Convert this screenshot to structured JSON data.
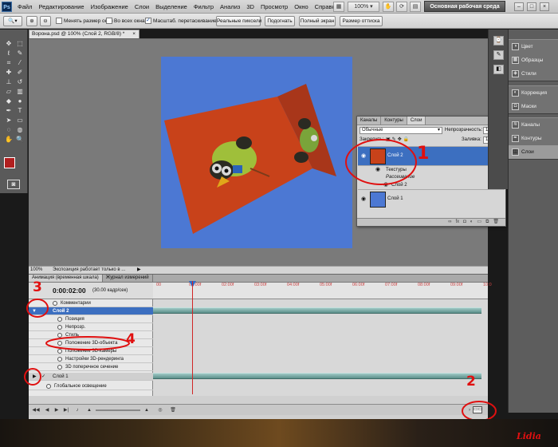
{
  "app": {
    "logo": "Ps",
    "menu": [
      "Файл",
      "Редактирование",
      "Изображение",
      "Слои",
      "Выделение",
      "Фильтр",
      "Анализ",
      "3D",
      "Просмотр",
      "Окно",
      "Справка"
    ],
    "zoom_label": "100%",
    "workspace_button": "Основная рабочая среда"
  },
  "options": {
    "check_resize": "Менять размер окон",
    "check_all_windows": "Во всех окнах",
    "check_scrubby": "Масштаб. перетаскиванием",
    "btn_actual_pixels": "Реальные пиксели",
    "btn_fit": "Подогнать",
    "btn_fullscreen": "Полный экран",
    "btn_print_size": "Размер оттиска"
  },
  "document": {
    "tab_title": "Ворона.psd @ 100% (Слой 2, RGB/8) *",
    "tab_close": "×",
    "status_zoom": "100%",
    "status_text": "Экспозиция работает только в ..."
  },
  "colors": {
    "canvas_blue": "#4c78d3",
    "cube_red": "#c8421a",
    "selection_blue": "#3c6fc0",
    "annotation_red": "#e01010"
  },
  "layers": {
    "tabs": [
      "Каналы",
      "Контуры",
      "Слои"
    ],
    "blend_mode": "Обычные",
    "opacity_label": "Непрозрачность:",
    "opacity_value": "100%",
    "lock_label": "Закрепить:",
    "fill_label": "Заливка:",
    "fill_value": "100%",
    "items": [
      {
        "name": "Слой 2",
        "sub": [
          "Текстуры",
          "Рассеивание",
          "Слой 2"
        ]
      },
      {
        "name": "Слой 1"
      }
    ]
  },
  "right_dock": {
    "group1": [
      "Цвет",
      "Образцы",
      "Стили"
    ],
    "group2": [
      "Коррекция",
      "Маски"
    ],
    "group3": [
      "Каналы",
      "Контуры",
      "Слои"
    ]
  },
  "animation": {
    "tabs": [
      "Анимация (временная шкала)",
      "Журнал измерений"
    ],
    "timecode": "0:00:02:00",
    "fps": "(30.00 кадр/сек)",
    "ruler_ticks": [
      "00",
      "01:00f",
      "02:00f",
      "03:00f",
      "04:00f",
      "05:00f",
      "06:00f",
      "07:00f",
      "08:00f",
      "09:00f",
      "10:0"
    ],
    "tracks": [
      "Комментарии",
      "Слой 2",
      "Позиция",
      "Непрозр.",
      "Стиль",
      "Положение 3D-объекта",
      "Положение 3D-камеры",
      "Настройки 3D-рендеринга",
      "3D поперечное сечение",
      "Слой 1",
      "Глобальное освещение"
    ]
  },
  "annotations": {
    "n1": "1",
    "n2": "2",
    "n3": "3",
    "n4": "4",
    "signature": "Lidia"
  }
}
